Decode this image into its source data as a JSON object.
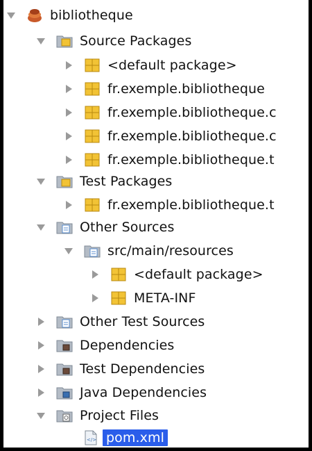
{
  "tree": {
    "nodes": [
      {
        "label": "bibliotheque",
        "icon": "maven-project-icon",
        "state": "expanded"
      },
      {
        "label": "Source Packages",
        "icon": "source-packages-folder-icon",
        "state": "expanded"
      },
      {
        "label": "<default package>",
        "icon": "package-icon",
        "state": "collapsed"
      },
      {
        "label": "fr.exemple.bibliotheque",
        "icon": "package-icon",
        "state": "collapsed"
      },
      {
        "label": "fr.exemple.bibliotheque.c",
        "icon": "package-icon",
        "state": "collapsed"
      },
      {
        "label": "fr.exemple.bibliotheque.c",
        "icon": "package-icon",
        "state": "collapsed"
      },
      {
        "label": "fr.exemple.bibliotheque.t",
        "icon": "package-icon",
        "state": "collapsed"
      },
      {
        "label": "Test Packages",
        "icon": "test-packages-folder-icon",
        "state": "expanded"
      },
      {
        "label": "fr.exemple.bibliotheque.t",
        "icon": "package-icon",
        "state": "collapsed"
      },
      {
        "label": "Other Sources",
        "icon": "other-sources-folder-icon",
        "state": "expanded"
      },
      {
        "label": "src/main/resources",
        "icon": "resources-folder-icon",
        "state": "expanded"
      },
      {
        "label": "<default package>",
        "icon": "package-icon",
        "state": "collapsed"
      },
      {
        "label": "META-INF",
        "icon": "package-icon",
        "state": "collapsed"
      },
      {
        "label": "Other Test Sources",
        "icon": "other-sources-folder-icon",
        "state": "collapsed"
      },
      {
        "label": "Dependencies",
        "icon": "dependencies-folder-icon",
        "state": "collapsed"
      },
      {
        "label": "Test Dependencies",
        "icon": "dependencies-folder-icon",
        "state": "collapsed"
      },
      {
        "label": "Java Dependencies",
        "icon": "java-dependencies-folder-icon",
        "state": "collapsed"
      },
      {
        "label": "Project Files",
        "icon": "project-files-folder-icon",
        "state": "expanded"
      },
      {
        "label": "pom.xml",
        "icon": "xml-file-icon",
        "state": "leaf",
        "selected": true
      }
    ]
  },
  "colors": {
    "selection": "#2a5dea",
    "package_yellow": "#f2c335",
    "folder_gray": "#b4bcc6",
    "folder_blue": "#5b8fd0",
    "toggle_gray": "#9a9a9a"
  }
}
